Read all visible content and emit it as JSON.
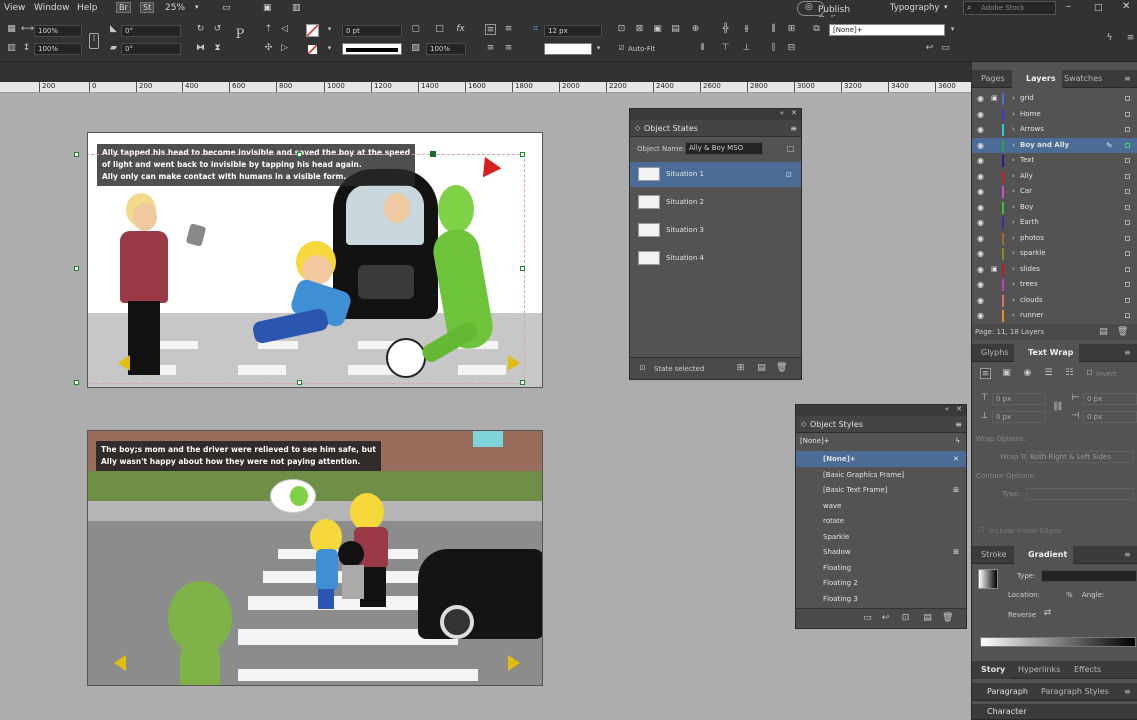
{
  "menu": {
    "items": [
      "View",
      "Window",
      "Help"
    ],
    "br": "Br",
    "st": "St",
    "zoom": "25%",
    "publish": "Publish Online",
    "workspace": "Typography",
    "search_placeholder": "Adobe Stock"
  },
  "control": {
    "scale_x": "100%",
    "scale_y": "100%",
    "rotation": "0°",
    "shear": "0°",
    "stroke_weight": "0 pt",
    "opacity": "100%",
    "corner_size": "12 px",
    "autofit": "Auto-Fit",
    "object_style": "[None]+"
  },
  "ruler": {
    "ticks": [
      "200",
      "0",
      "200",
      "400",
      "600",
      "800",
      "1000",
      "1200",
      "1400",
      "1600",
      "1800",
      "2000",
      "2200",
      "2400",
      "2600",
      "2800",
      "3000",
      "3200",
      "3400",
      "3600"
    ]
  },
  "pages": {
    "top_caption": "Ally tapped his head to become invisible and saved the boy at the speed\nof light and went back to invisible by tapping his head again.\nAlly only can make contact with humans in a visible form.",
    "bottom_caption": "The boy;s mom and the driver were relieved to see him safe, but\nAlly wasn't happy about how they were not paying attention."
  },
  "object_states": {
    "title": "Object States",
    "name_label": "Object Name:",
    "name_value": "Ally & Boy MSO",
    "states": [
      "Situation 1",
      "Situation 2",
      "Situation 3",
      "Situation 4"
    ],
    "footer": "State selected"
  },
  "object_styles": {
    "title": "Object Styles",
    "current": "[None]+",
    "items": [
      "[None]+",
      "[Basic Graphics Frame]",
      "[Basic Text Frame]",
      "wave",
      "rotate",
      "Sparkle",
      "Shadow",
      "Floating",
      "Floating 2",
      "Floating 3"
    ]
  },
  "layers_panel": {
    "tabs": [
      "Pages",
      "Layers",
      "Swatches"
    ],
    "layers": [
      {
        "name": "grid",
        "color": "#4a6ee0",
        "locked": true
      },
      {
        "name": "Home",
        "color": "#3b3bd6",
        "locked": false
      },
      {
        "name": "Arrows",
        "color": "#2fcfd1",
        "locked": false
      },
      {
        "name": "Boy and Ally",
        "color": "#2aa44a",
        "locked": false
      },
      {
        "name": "Text",
        "color": "#1d1d9a",
        "locked": false
      },
      {
        "name": "Ally",
        "color": "#cc2222",
        "locked": false
      },
      {
        "name": "Car",
        "color": "#d050d0",
        "locked": false
      },
      {
        "name": "Boy",
        "color": "#36c23c",
        "locked": false
      },
      {
        "name": "Earth",
        "color": "#2f2fa8",
        "locked": false
      },
      {
        "name": "photos",
        "color": "#a06a30",
        "locked": false
      },
      {
        "name": "sparkle",
        "color": "#8a8a2a",
        "locked": false
      },
      {
        "name": "slides",
        "color": "#c01e1e",
        "locked": true
      },
      {
        "name": "trees",
        "color": "#c040c0",
        "locked": false
      },
      {
        "name": "clouds",
        "color": "#e07070",
        "locked": false
      },
      {
        "name": "runner",
        "color": "#e09020",
        "locked": false
      }
    ],
    "footer": "Page: 11, 18 Layers"
  },
  "text_wrap": {
    "tabs": [
      "Glyphs",
      "Text Wrap"
    ],
    "invert": "Invert",
    "offsets": [
      "0 px",
      "0 px",
      "0 px",
      "0 px"
    ],
    "wrap_options": "Wrap Options:",
    "wrap_to_label": "Wrap To:",
    "wrap_to_value": "Both Right & Left Sides",
    "contour_options": "Contour Options:",
    "type_label": "Type:",
    "include_inside": "Include Inside Edges"
  },
  "gradient": {
    "tabs": [
      "Stroke",
      "Gradient"
    ],
    "type_label": "Type:",
    "location_label": "Location:",
    "pct": "%",
    "angle_label": "Angle:",
    "reverse": "Reverse"
  },
  "bottom_tabs": {
    "row1": [
      "Story",
      "Hyperlinks",
      "Effects"
    ],
    "paragraph": "Paragraph",
    "paragraph_styles": "Paragraph Styles",
    "character": "Character"
  }
}
